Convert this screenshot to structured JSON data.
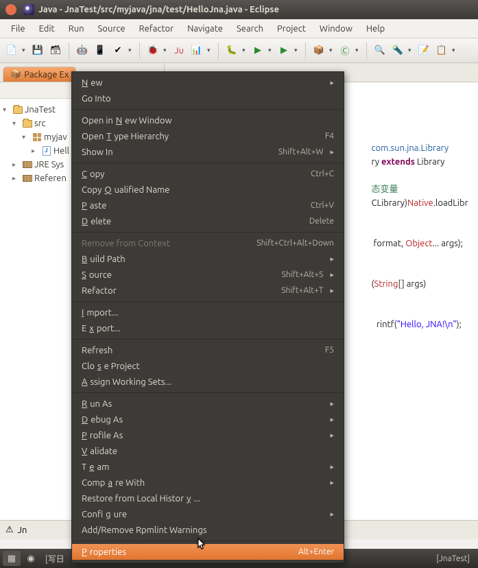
{
  "title": "Java - JnaTest/src/myjava/jna/test/HelloJna.java - Eclipse",
  "menus": [
    "File",
    "Edit",
    "Run",
    "Source",
    "Refactor",
    "Navigate",
    "Search",
    "Project",
    "Window",
    "Help"
  ],
  "package_explorer_tab": "Package Ex",
  "tree": {
    "project": "JnaTest",
    "src": "src",
    "pkg": "myjav",
    "file": "Hell",
    "jre": "JRE Sys",
    "ref": "Referen"
  },
  "editor": {
    "tab": "Jn",
    "text1": ";",
    "imp_pkg": "com.sun.jna.Library",
    "line2a": "ry ",
    "kw_extends": "extends",
    "line2b": " Library",
    "cmt": "态变量",
    "cast": "CLibrary)",
    "native": "Native",
    "call1": ".loadLibr",
    "fmt1": " format, ",
    "obj": "Object",
    "fmt2": "... args);",
    "main1": "(",
    "string": "String",
    "main2": "[] args)",
    "printf": "rintf(",
    "strlit": "\"Hello, JNA!\\n\"",
    "printfend": ");"
  },
  "context_menu": [
    {
      "label": "New",
      "u": "N",
      "arrow": true
    },
    {
      "label": "Go Into"
    },
    {
      "sep": true
    },
    {
      "label": "Open in New Window",
      "u": "N"
    },
    {
      "label": "Open Type Hierarchy",
      "u": "T",
      "sc": "F4"
    },
    {
      "label": "Show In",
      "u": "W",
      "sc": "Shift+Alt+W",
      "arrow": true
    },
    {
      "sep": true
    },
    {
      "label": "Copy",
      "u": "C",
      "sc": "Ctrl+C"
    },
    {
      "label": "Copy Qualified Name",
      "u": "Q"
    },
    {
      "label": "Paste",
      "u": "P",
      "sc": "Ctrl+V"
    },
    {
      "label": "Delete",
      "u": "D",
      "sc": "Delete"
    },
    {
      "sep": true
    },
    {
      "label": "Remove from Context",
      "disabled": true,
      "sc": "Shift+Ctrl+Alt+Down"
    },
    {
      "label": "Build Path",
      "u": "B",
      "arrow": true
    },
    {
      "label": "Source",
      "u": "S",
      "sc": "Shift+Alt+S",
      "arrow": true
    },
    {
      "label": "Refactor",
      "u": "T",
      "sc": "Shift+Alt+T",
      "arrow": true
    },
    {
      "sep": true
    },
    {
      "label": "Import...",
      "u": "I"
    },
    {
      "label": "Export...",
      "u": "x"
    },
    {
      "sep": true
    },
    {
      "label": "Refresh",
      "u": "F",
      "sc": "F5"
    },
    {
      "label": "Close Project",
      "u": "s"
    },
    {
      "label": "Assign Working Sets...",
      "u": "A"
    },
    {
      "sep": true
    },
    {
      "label": "Run As",
      "u": "R",
      "arrow": true
    },
    {
      "label": "Debug As",
      "u": "D",
      "arrow": true
    },
    {
      "label": "Profile As",
      "u": "P",
      "arrow": true
    },
    {
      "label": "Validate",
      "u": "V"
    },
    {
      "label": "Team",
      "u": "e",
      "arrow": true
    },
    {
      "label": "Compare With",
      "u": "a",
      "arrow": true
    },
    {
      "label": "Restore from Local History...",
      "u": "y"
    },
    {
      "label": "Configure",
      "u": "g",
      "arrow": true
    },
    {
      "label": "Add/Remove Rpmlint Warnings"
    },
    {
      "sep": true
    },
    {
      "label": "Properties",
      "u": "P",
      "sc": "Alt+Enter",
      "highlight": true
    }
  ],
  "taskbar": {
    "screenshot": "[写日",
    "bracket": "[JnaTest]"
  }
}
